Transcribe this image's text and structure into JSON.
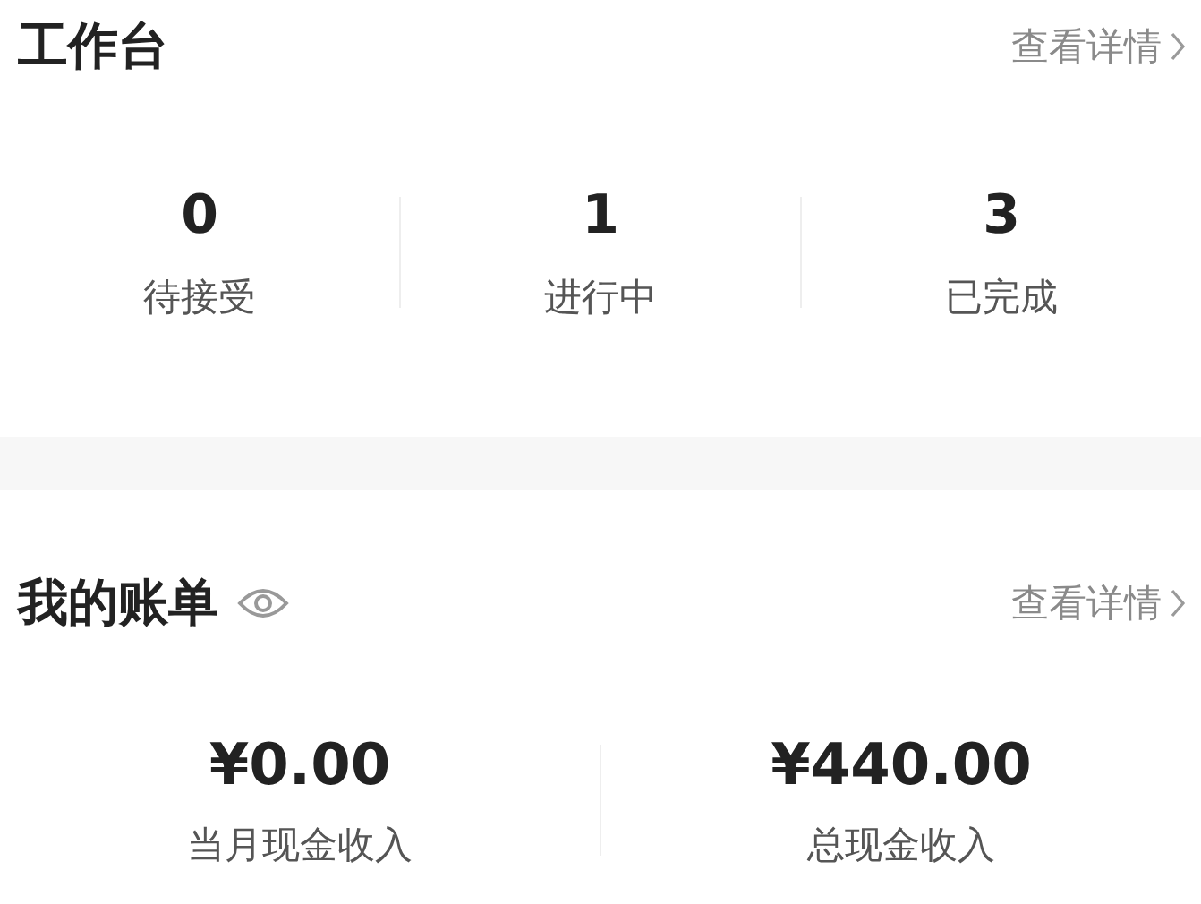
{
  "workbench": {
    "title": "工作台",
    "link": "查看详情",
    "stats": [
      {
        "value": "0",
        "label": "待接受"
      },
      {
        "value": "1",
        "label": "进行中"
      },
      {
        "value": "3",
        "label": "已完成"
      }
    ]
  },
  "bill": {
    "title": "我的账单",
    "link": "查看详情",
    "stats": [
      {
        "value": "¥0.00",
        "label": "当月现金收入"
      },
      {
        "value": "¥440.00",
        "label": "总现金收入"
      }
    ]
  }
}
